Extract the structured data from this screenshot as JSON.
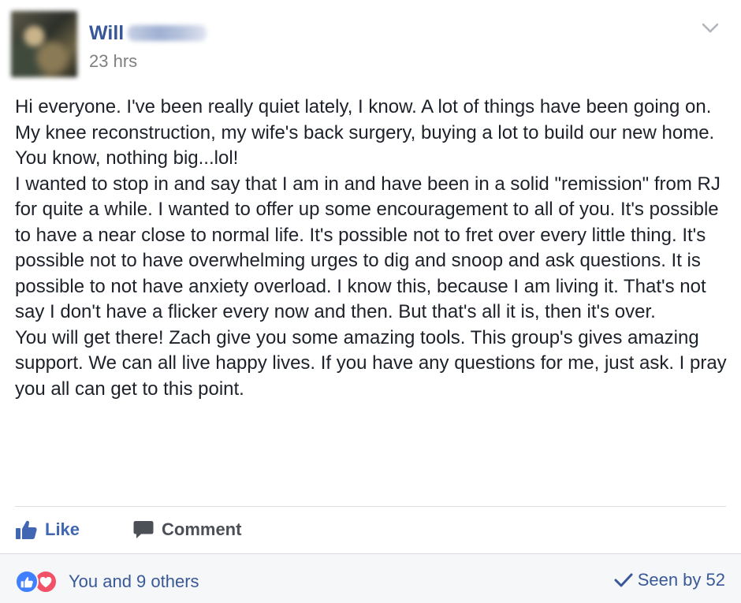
{
  "post": {
    "author": "Will",
    "timestamp": "23 hrs",
    "paragraphs": [
      "Hi everyone. I've been really quiet lately, I know. A lot of things have been going on. My knee reconstruction, my wife's back surgery, buying a lot to build our new home. You know, nothing big...lol!",
      "I wanted to stop in and say that I am in and have been in a solid \"remission\" from RJ for quite a while. I wanted to offer up some encouragement to all of you. It's possible to have a near close to normal life. It's possible not to fret over every little thing. It's possible not to have overwhelming urges to dig and snoop and ask questions. It is possible to not have anxiety overload. I know this, because I am living it. That's not say I don't have a flicker every now and then. But that's all it is, then it's over.",
      "You will get there! Zach give you some amazing tools. This group's gives amazing support. We can all live happy lives. If you have any questions for me, just ask. I pray you all can get to this point."
    ]
  },
  "actions": {
    "like_label": "Like",
    "comment_label": "Comment"
  },
  "footer": {
    "reactions_text": "You and 9 others",
    "seen_text": "Seen by 52"
  },
  "icons": {
    "menu": "chevron-down-icon",
    "like": "thumbs-up-icon",
    "comment": "speech-bubble-icon",
    "reaction_like": "like-reaction-icon",
    "reaction_love": "heart-reaction-icon",
    "seen": "checkmark-icon"
  },
  "colors": {
    "link_blue": "#365899",
    "like_blue": "#4267b2",
    "love_red": "#f25268",
    "reaction_blue": "#4080ff",
    "muted_text": "#7f7f7f",
    "footer_bg": "#f6f7f9"
  }
}
